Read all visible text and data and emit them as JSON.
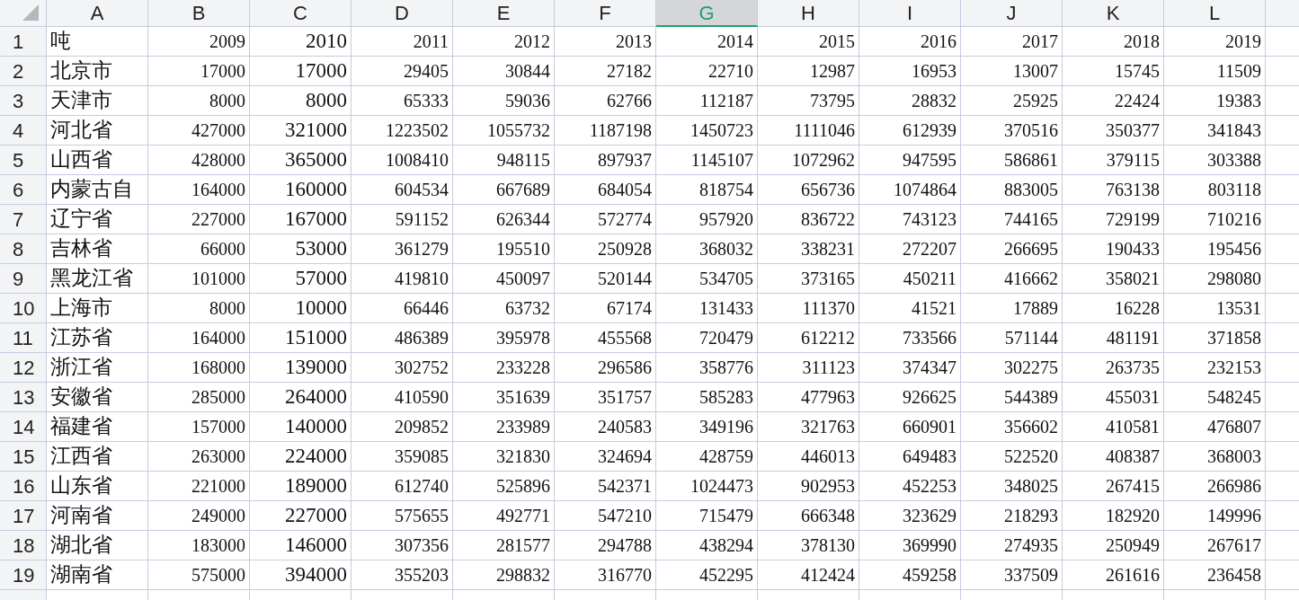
{
  "columns": [
    {
      "label": "A",
      "selected": false
    },
    {
      "label": "B",
      "selected": false
    },
    {
      "label": "C",
      "selected": false
    },
    {
      "label": "D",
      "selected": false
    },
    {
      "label": "E",
      "selected": false
    },
    {
      "label": "F",
      "selected": false
    },
    {
      "label": "G",
      "selected": true
    },
    {
      "label": "H",
      "selected": false
    },
    {
      "label": "I",
      "selected": false
    },
    {
      "label": "J",
      "selected": false
    },
    {
      "label": "K",
      "selected": false
    },
    {
      "label": "L",
      "selected": false
    }
  ],
  "rows": [
    {
      "number": "1",
      "cells": [
        "吨",
        "2009",
        "2010",
        "2011",
        "2012",
        "2013",
        "2014",
        "2015",
        "2016",
        "2017",
        "2018",
        "2019"
      ]
    },
    {
      "number": "2",
      "cells": [
        "北京市",
        "17000",
        "17000",
        "29405",
        "30844",
        "27182",
        "22710",
        "12987",
        "16953",
        "13007",
        "15745",
        "11509"
      ]
    },
    {
      "number": "3",
      "cells": [
        "天津市",
        "8000",
        "8000",
        "65333",
        "59036",
        "62766",
        "112187",
        "73795",
        "28832",
        "25925",
        "22424",
        "19383"
      ]
    },
    {
      "number": "4",
      "cells": [
        "河北省",
        "427000",
        "321000",
        "1223502",
        "1055732",
        "1187198",
        "1450723",
        "1111046",
        "612939",
        "370516",
        "350377",
        "341843"
      ]
    },
    {
      "number": "5",
      "cells": [
        "山西省",
        "428000",
        "365000",
        "1008410",
        "948115",
        "897937",
        "1145107",
        "1072962",
        "947595",
        "586861",
        "379115",
        "303388"
      ]
    },
    {
      "number": "6",
      "cells": [
        "内蒙古自",
        "164000",
        "160000",
        "604534",
        "667689",
        "684054",
        "818754",
        "656736",
        "1074864",
        "883005",
        "763138",
        "803118"
      ]
    },
    {
      "number": "7",
      "cells": [
        "辽宁省",
        "227000",
        "167000",
        "591152",
        "626344",
        "572774",
        "957920",
        "836722",
        "743123",
        "744165",
        "729199",
        "710216"
      ]
    },
    {
      "number": "8",
      "cells": [
        "吉林省",
        "66000",
        "53000",
        "361279",
        "195510",
        "250928",
        "368032",
        "338231",
        "272207",
        "266695",
        "190433",
        "195456"
      ]
    },
    {
      "number": "9",
      "cells": [
        "黑龙江省",
        "101000",
        "57000",
        "419810",
        "450097",
        "520144",
        "534705",
        "373165",
        "450211",
        "416662",
        "358021",
        "298080"
      ]
    },
    {
      "number": "10",
      "cells": [
        "上海市",
        "8000",
        "10000",
        "66446",
        "63732",
        "67174",
        "131433",
        "111370",
        "41521",
        "17889",
        "16228",
        "13531"
      ]
    },
    {
      "number": "11",
      "cells": [
        "江苏省",
        "164000",
        "151000",
        "486389",
        "395978",
        "455568",
        "720479",
        "612212",
        "733566",
        "571144",
        "481191",
        "371858"
      ]
    },
    {
      "number": "12",
      "cells": [
        "浙江省",
        "168000",
        "139000",
        "302752",
        "233228",
        "296586",
        "358776",
        "311123",
        "374347",
        "302275",
        "263735",
        "232153"
      ]
    },
    {
      "number": "13",
      "cells": [
        "安徽省",
        "285000",
        "264000",
        "410590",
        "351639",
        "351757",
        "585283",
        "477963",
        "926625",
        "544389",
        "455031",
        "548245"
      ]
    },
    {
      "number": "14",
      "cells": [
        "福建省",
        "157000",
        "140000",
        "209852",
        "233989",
        "240583",
        "349196",
        "321763",
        "660901",
        "356602",
        "410581",
        "476807"
      ]
    },
    {
      "number": "15",
      "cells": [
        "江西省",
        "263000",
        "224000",
        "359085",
        "321830",
        "324694",
        "428759",
        "446013",
        "649483",
        "522520",
        "408387",
        "368003"
      ]
    },
    {
      "number": "16",
      "cells": [
        "山东省",
        "221000",
        "189000",
        "612740",
        "525896",
        "542371",
        "1024473",
        "902953",
        "452253",
        "348025",
        "267415",
        "266986"
      ]
    },
    {
      "number": "17",
      "cells": [
        "河南省",
        "249000",
        "227000",
        "575655",
        "492771",
        "547210",
        "715479",
        "666348",
        "323629",
        "218293",
        "182920",
        "149996"
      ]
    },
    {
      "number": "18",
      "cells": [
        "湖北省",
        "183000",
        "146000",
        "307356",
        "281577",
        "294788",
        "438294",
        "378130",
        "369990",
        "274935",
        "250949",
        "267617"
      ]
    },
    {
      "number": "19",
      "cells": [
        "湖南省",
        "575000",
        "394000",
        "355203",
        "298832",
        "316770",
        "452295",
        "412424",
        "459258",
        "337509",
        "261616",
        "236458"
      ]
    }
  ]
}
